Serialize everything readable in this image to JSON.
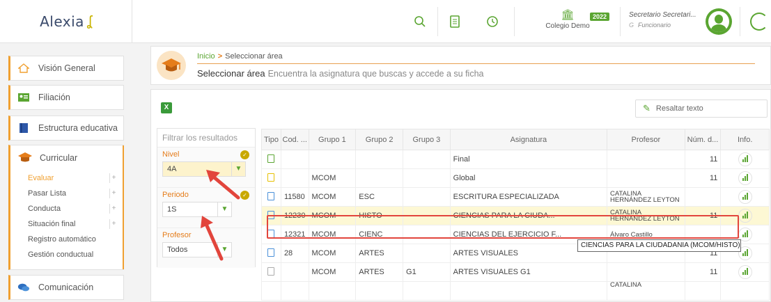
{
  "app": {
    "logo": "Alexia"
  },
  "topbar": {
    "colegio": "Colegio Demo",
    "year": "2022",
    "user_name": "Secretario Secretari...",
    "user_role": "Funcionario",
    "user_prefix": "G"
  },
  "sidebar": {
    "items": [
      {
        "label": "Visión General",
        "icon": "home-icon"
      },
      {
        "label": "Filiación",
        "icon": "id-card-icon"
      },
      {
        "label": "Estructura educativa",
        "icon": "book-icon"
      }
    ],
    "curricular": {
      "label": "Curricular",
      "subitems": [
        {
          "label": "Evaluar",
          "plus": "+"
        },
        {
          "label": "Pasar Lista",
          "plus": "+"
        },
        {
          "label": "Conducta",
          "plus": "+"
        },
        {
          "label": "Situación final",
          "plus": "+"
        },
        {
          "label": "Registro automático"
        },
        {
          "label": "Gestión conductual"
        }
      ]
    },
    "comunicacion": "Comunicación"
  },
  "header": {
    "crumb_home": "Inicio",
    "crumb_sep": ">",
    "crumb_current": "Seleccionar área",
    "title": "Seleccionar área",
    "subtitle": "Encuentra la asignatura que buscas y accede a su ficha"
  },
  "toolbar": {
    "highlight": "Resaltar texto",
    "excel": "X"
  },
  "filters": {
    "title": "Filtrar los resultados",
    "nivel_label": "Nivel",
    "nivel_value": "4A",
    "periodo_label": "Periodo",
    "periodo_value": "1S",
    "profesor_label": "Profesor",
    "profesor_value": "Todos"
  },
  "table": {
    "headers": [
      "Tipo",
      "Cod. ...",
      "Grupo 1",
      "Grupo 2",
      "Grupo 3",
      "Asignatura",
      "Profesor",
      "Núm. d...",
      "Info."
    ],
    "rows": [
      {
        "icon": "green",
        "cod": "",
        "g1": "",
        "g2": "",
        "g3": "",
        "asig": "Final",
        "prof": "",
        "num": "11"
      },
      {
        "icon": "yellow",
        "cod": "",
        "g1": "MCOM",
        "g2": "",
        "g3": "",
        "asig": "Global",
        "prof": "",
        "num": "11"
      },
      {
        "icon": "blue",
        "cod": "11580",
        "g1": "MCOM",
        "g2": "ESC",
        "g3": "",
        "asig": "ESCRITURA ESPECIALIZADA",
        "prof": "CATALINA HERNÁNDEZ LEYTON",
        "num": ""
      },
      {
        "icon": "blue",
        "cod": "12230",
        "g1": "MCOM",
        "g2": "HISTO",
        "g3": "",
        "asig": "CIENCIAS PARA LA CIUDA...",
        "prof": "CATALINA HERNÁNDEZ LEYTON",
        "num": "11"
      },
      {
        "icon": "blue",
        "cod": "12321",
        "g1": "MCOM",
        "g2": "CIENC",
        "g3": "",
        "asig": "CIENCIAS DEL EJERCICIO F...",
        "prof": "Álvaro Castillo",
        "num": ""
      },
      {
        "icon": "blue",
        "cod": "28",
        "g1": "MCOM",
        "g2": "ARTES",
        "g3": "",
        "asig": "ARTES VISUALES",
        "prof": "",
        "num": "11"
      },
      {
        "icon": "grey",
        "cod": "",
        "g1": "MCOM",
        "g2": "ARTES",
        "g3": "G1",
        "asig": "ARTES VISUALES G1",
        "prof": "",
        "num": "11"
      }
    ],
    "partial_row_prof": "CATALINA",
    "tooltip": "CIENCIAS PARA LA CIUDADANIA (MCOM/HISTO)"
  }
}
